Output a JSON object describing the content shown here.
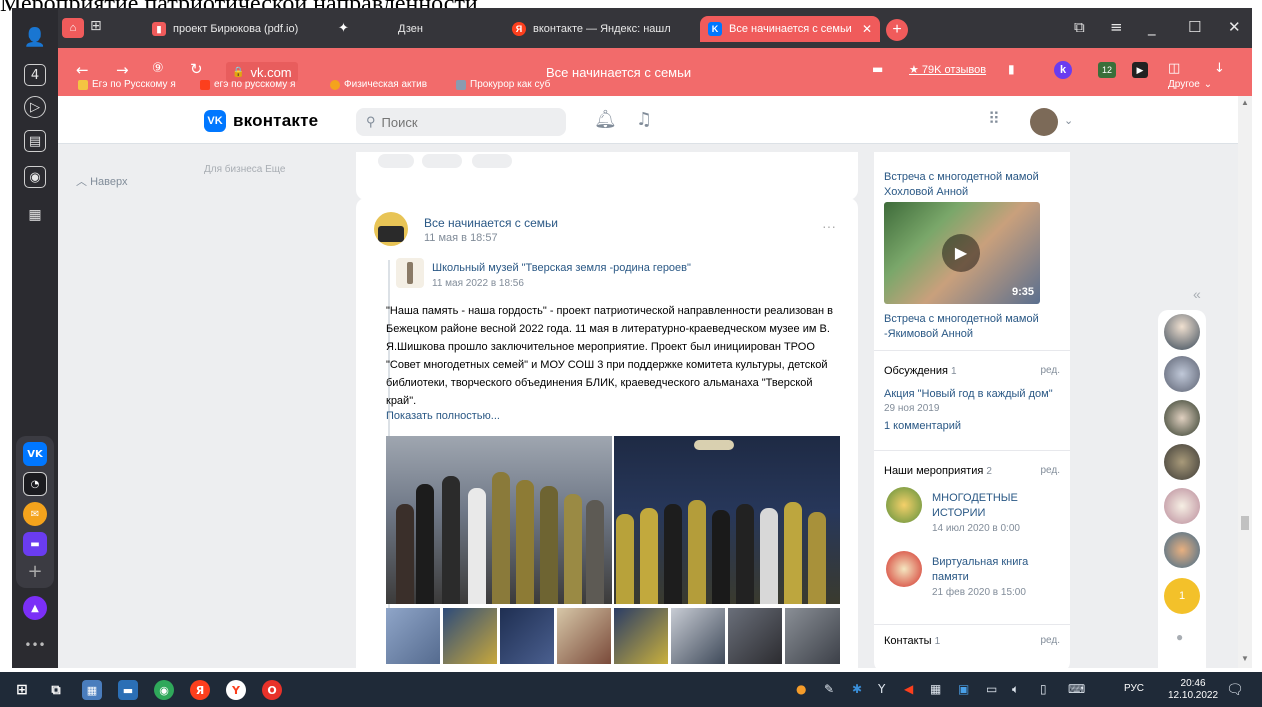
{
  "caption": "Мероприятие патриотической направленности",
  "tabs": [
    {
      "label": "проект Бирюкова (pdf.io)"
    },
    {
      "label": "Дзен"
    },
    {
      "label": "вконтакте — Яндекс: нашл"
    },
    {
      "label": "Все начинается с семьи"
    }
  ],
  "tab_count": "4",
  "toolbar": {
    "url": "vk.com",
    "page_title": "Все начинается с семьи",
    "reviews": "★ 79K отзывов"
  },
  "bookmarks": [
    {
      "label": "Егэ по Русскому я"
    },
    {
      "label": "егэ по русскому я"
    },
    {
      "label": "Физическая актив"
    },
    {
      "label": "Прокурор как суб"
    }
  ],
  "bookmarks_other": "Другое",
  "vk": {
    "logo": "вконтакте",
    "search_placeholder": "Поиск",
    "scroll_up": "Наверх",
    "biz_links": "Для бизнеса   Еще"
  },
  "post": {
    "author": "Все начинается с семьи",
    "date": "11 мая в 18:57",
    "repost_author": "Школьный музей \"Тверская земля -родина героев\"",
    "repost_date": "11 мая 2022 в 18:56",
    "text": "\"Наша память - наша гордость\" - проект патриотической направленности реализован в Бежецком районе весной 2022 года. 11 мая в литературно-краеведческом музее им В. Я.Шишкова прошло заключительное мероприятие. Проект был инициирован ТРОО \"Совет многодетных семей\" и МОУ СОШ 3 при поддержке комитета культуры, детской библиотеки, творческого объединения БЛИК, краеведческого альманаха \"Тверской край\".",
    "show_more": "Показать полностью..."
  },
  "right": {
    "video1_title": "Встреча с многодетной мамой Хохловой Анной",
    "video_duration": "9:35",
    "video2_title": "Встреча с многодетной мамой -Якимовой Анной",
    "discussions_label": "Обсуждения",
    "discussions_count": "1",
    "edit": "ред.",
    "discussion_topic": "Акция \"Новый год в каждый дом\"",
    "discussion_date": "29 ноя 2019",
    "discussion_comments": "1 комментарий",
    "events_label": "Наши мероприятия",
    "events_count": "2",
    "event1_title": "МНОГОДЕТНЫЕ ИСТОРИИ",
    "event1_date": "14 июл 2020 в 0:00",
    "event2_title": "Виртуальная книга памяти",
    "event2_date": "21 фев 2020 в 15:00",
    "contacts_label": "Контакты",
    "contacts_count": "1"
  },
  "friends_badge": "1",
  "taskbar": {
    "lang": "РУС",
    "time": "20:46",
    "date": "12.10.2022"
  },
  "colors": {
    "toolbar_red": "#f26b6b",
    "vk_blue": "#0077ff",
    "link_blue": "#2a5885"
  }
}
